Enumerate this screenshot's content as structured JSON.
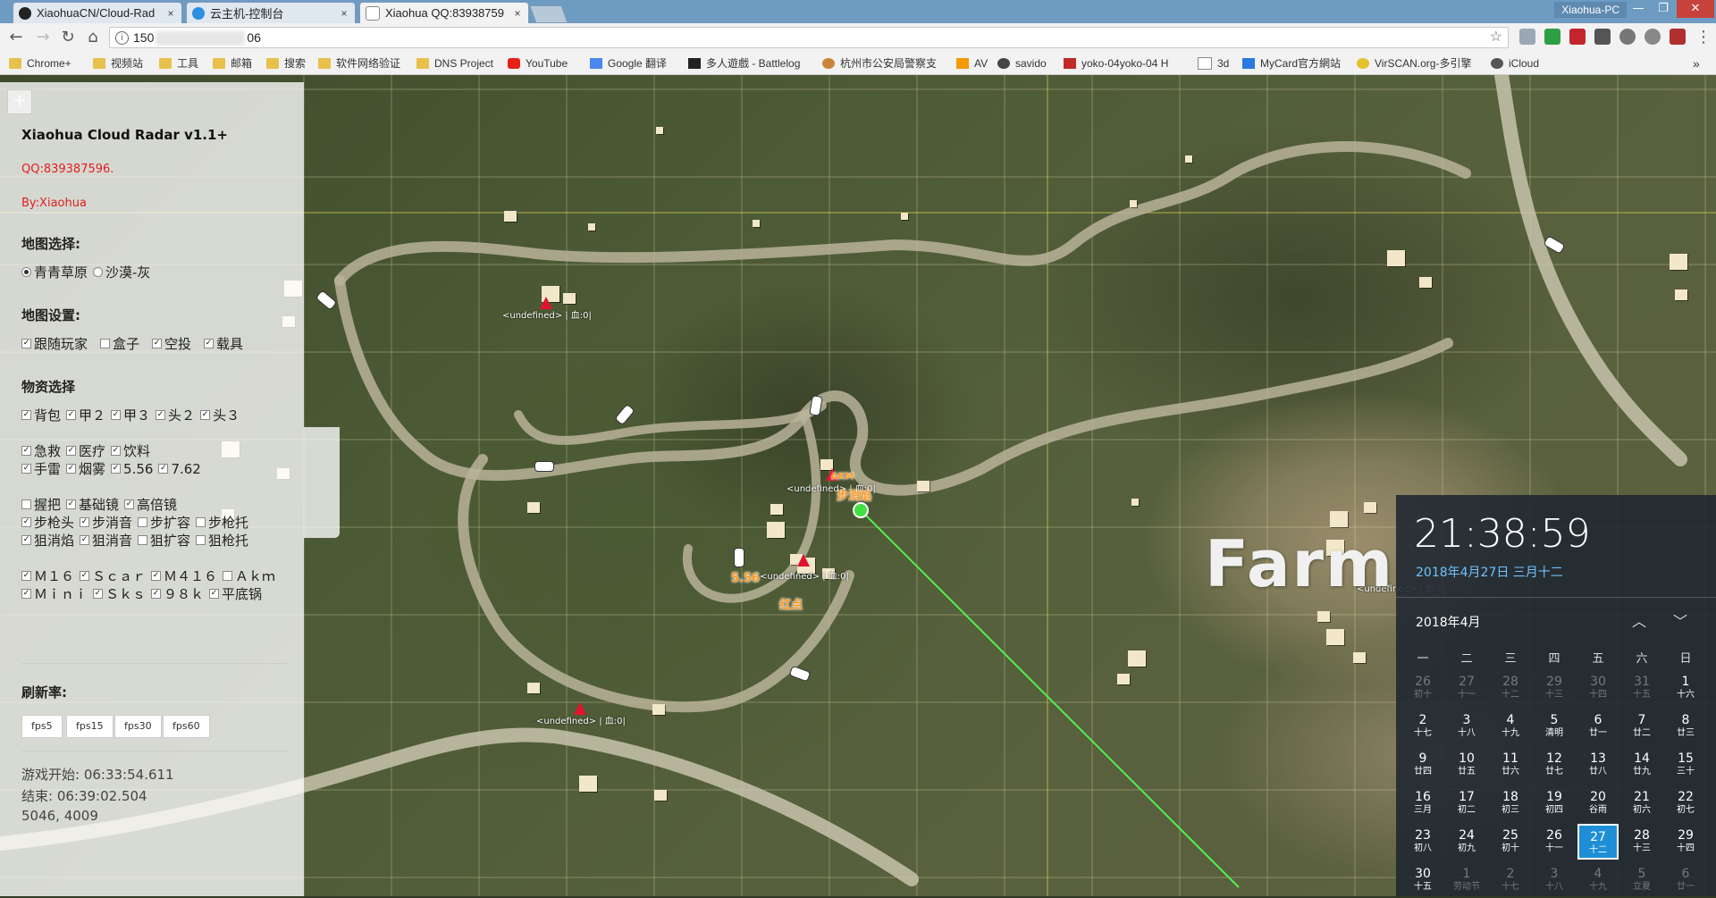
{
  "browser": {
    "tabs": [
      {
        "label": "XiaohuaCN/Cloud-Rad",
        "close": "×",
        "active": false
      },
      {
        "label": "云主机-控制台",
        "close": "×",
        "active": false
      },
      {
        "label": "Xiaohua QQ:83938759",
        "close": "×",
        "active": true
      }
    ],
    "user": "Xiaohua-PC",
    "window_buttons": [
      "—",
      "❐",
      "✕"
    ],
    "url_start": "150",
    "url_end": "06",
    "bookmarks": [
      {
        "label": "Chrome+",
        "icon": "folder-icon"
      },
      {
        "label": "视频站",
        "icon": "folder-icon"
      },
      {
        "label": "工具",
        "icon": "folder-icon"
      },
      {
        "label": "邮箱",
        "icon": "folder-icon"
      },
      {
        "label": "搜索",
        "icon": "folder-icon"
      },
      {
        "label": "软件网络验证",
        "icon": "folder-icon"
      },
      {
        "label": "DNS Project",
        "icon": "folder-icon"
      },
      {
        "label": "YouTube",
        "icon": "youtube-icon"
      },
      {
        "label": "Google 翻译",
        "icon": "translate-icon"
      },
      {
        "label": "多人遊戲 - Battlelog",
        "icon": "battlelog-icon"
      },
      {
        "label": "杭州市公安局警察支",
        "icon": "police-icon"
      },
      {
        "label": "AV",
        "icon": "ph-icon"
      },
      {
        "label": "savido",
        "icon": "cloud-icon"
      },
      {
        "label": "yoko-04yoko-04 H",
        "icon": "s-icon"
      },
      {
        "label": "3d",
        "icon": "page-icon"
      },
      {
        "label": "MyCard官方網站",
        "icon": "mycard-icon"
      },
      {
        "label": "VirSCAN.org-多引擎",
        "icon": "virscan-icon"
      },
      {
        "label": "iCloud",
        "icon": "apple-icon"
      }
    ],
    "bookmarks_more": "»"
  },
  "panel": {
    "zoom": "+",
    "title": "Xiaohua Cloud Radar v1.1+",
    "qq": "QQ:839387596.",
    "by": "By:Xiaohua",
    "map_select_label": "地图选择:",
    "maps": [
      {
        "label": "青青草原",
        "checked": true
      },
      {
        "label": "沙漠-灰",
        "checked": false
      }
    ],
    "map_settings_label": "地图设置:",
    "map_settings": [
      {
        "label": "跟随玩家",
        "checked": true
      },
      {
        "label": "盒子",
        "checked": false
      },
      {
        "label": "空投",
        "checked": true
      },
      {
        "label": "载具",
        "checked": true
      }
    ],
    "items_label": "物资选择",
    "item_rows": [
      [
        {
          "label": "背包",
          "checked": true
        },
        {
          "label": "甲２",
          "checked": true
        },
        {
          "label": "甲３",
          "checked": true
        },
        {
          "label": "头２",
          "checked": true
        },
        {
          "label": "头３",
          "checked": true
        }
      ],
      [
        {
          "label": "急救",
          "checked": true
        },
        {
          "label": "医疗",
          "checked": true
        },
        {
          "label": "饮料",
          "checked": true
        }
      ],
      [
        {
          "label": "手雷",
          "checked": true
        },
        {
          "label": "烟雾",
          "checked": true
        },
        {
          "label": "5.56",
          "checked": true
        },
        {
          "label": "7.62",
          "checked": true
        }
      ],
      [
        {
          "label": "握把",
          "checked": false
        },
        {
          "label": "基础镜",
          "checked": true
        },
        {
          "label": "高倍镜",
          "checked": true
        }
      ],
      [
        {
          "label": "步枪头",
          "checked": true
        },
        {
          "label": "步消音",
          "checked": true
        },
        {
          "label": "步扩容",
          "checked": false
        },
        {
          "label": "步枪托",
          "checked": false
        }
      ],
      [
        {
          "label": "狙消焰",
          "checked": true
        },
        {
          "label": "狙消音",
          "checked": true
        },
        {
          "label": "狙扩容",
          "checked": false
        },
        {
          "label": "狙枪托",
          "checked": false
        }
      ],
      [
        {
          "label": "Ｍ１６",
          "checked": true
        },
        {
          "label": "Ｓｃａｒ",
          "checked": true
        },
        {
          "label": "Ｍ４１６",
          "checked": true
        },
        {
          "label": "Ａｋｍ",
          "checked": false
        }
      ],
      [
        {
          "label": "Ｍｉｎｉ",
          "checked": true
        },
        {
          "label": "Ｓｋｓ",
          "checked": true
        },
        {
          "label": "９８ｋ",
          "checked": true
        },
        {
          "label": "平底锅",
          "checked": true
        }
      ]
    ],
    "refresh_label": "刷新率:",
    "fps_buttons": [
      "fps5",
      "fps15",
      "fps30",
      "fps60"
    ],
    "game_start": "游戏开始: 06:33:54.611",
    "game_end": "结束: 06:39:02.504",
    "coords": "5046, 4009"
  },
  "map": {
    "region_label": "Farm",
    "undefined_label": "<undefined> | 血:0|",
    "item_labels": [
      "步消焰",
      "5.56",
      "红点",
      "AKM"
    ],
    "colors": {
      "grid": "#e8e0b0",
      "line_to_target": "#50f050",
      "enemy": "#e0142e",
      "item_text": "#ff9a20"
    }
  },
  "clock": {
    "time": "21:38:59",
    "date": "2018年4月27日 三月十二",
    "month": "2018年4月",
    "up": "︿",
    "down": "﹀",
    "weekdays": [
      "一",
      "二",
      "三",
      "四",
      "五",
      "六",
      "日"
    ],
    "rows": [
      [
        {
          "d": "26",
          "l": "初十",
          "dim": true
        },
        {
          "d": "27",
          "l": "十一",
          "dim": true
        },
        {
          "d": "28",
          "l": "十二",
          "dim": true
        },
        {
          "d": "29",
          "l": "十三",
          "dim": true
        },
        {
          "d": "30",
          "l": "十四",
          "dim": true
        },
        {
          "d": "31",
          "l": "十五",
          "dim": true
        },
        {
          "d": "1",
          "l": "十六"
        }
      ],
      [
        {
          "d": "2",
          "l": "十七"
        },
        {
          "d": "3",
          "l": "十八"
        },
        {
          "d": "4",
          "l": "十九"
        },
        {
          "d": "5",
          "l": "清明"
        },
        {
          "d": "6",
          "l": "廿一"
        },
        {
          "d": "7",
          "l": "廿二"
        },
        {
          "d": "8",
          "l": "廿三"
        }
      ],
      [
        {
          "d": "9",
          "l": "廿四"
        },
        {
          "d": "10",
          "l": "廿五"
        },
        {
          "d": "11",
          "l": "廿六"
        },
        {
          "d": "12",
          "l": "廿七"
        },
        {
          "d": "13",
          "l": "廿八"
        },
        {
          "d": "14",
          "l": "廿九"
        },
        {
          "d": "15",
          "l": "三十"
        }
      ],
      [
        {
          "d": "16",
          "l": "三月"
        },
        {
          "d": "17",
          "l": "初二"
        },
        {
          "d": "18",
          "l": "初三"
        },
        {
          "d": "19",
          "l": "初四"
        },
        {
          "d": "20",
          "l": "谷雨"
        },
        {
          "d": "21",
          "l": "初六"
        },
        {
          "d": "22",
          "l": "初七"
        }
      ],
      [
        {
          "d": "23",
          "l": "初八"
        },
        {
          "d": "24",
          "l": "初九"
        },
        {
          "d": "25",
          "l": "初十"
        },
        {
          "d": "26",
          "l": "十一"
        },
        {
          "d": "27",
          "l": "十二",
          "today": true
        },
        {
          "d": "28",
          "l": "十三"
        },
        {
          "d": "29",
          "l": "十四"
        }
      ],
      [
        {
          "d": "30",
          "l": "十五"
        },
        {
          "d": "1",
          "l": "劳动节",
          "dim": true
        },
        {
          "d": "2",
          "l": "十七",
          "dim": true
        },
        {
          "d": "3",
          "l": "十八",
          "dim": true
        },
        {
          "d": "4",
          "l": "十九",
          "dim": true
        },
        {
          "d": "5",
          "l": "立夏",
          "dim": true
        },
        {
          "d": "6",
          "l": "廿一",
          "dim": true
        }
      ]
    ]
  }
}
